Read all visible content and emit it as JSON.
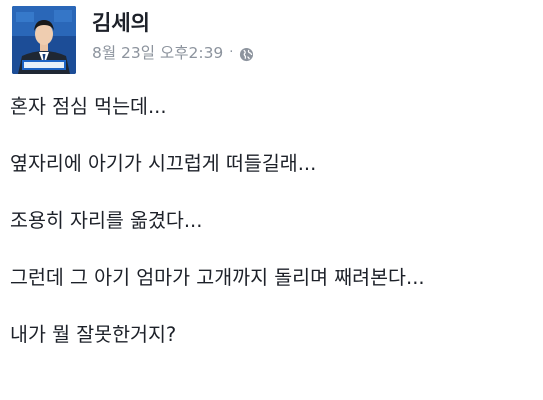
{
  "post": {
    "author": "김세의",
    "timestamp": "8월 23일 오후2:39",
    "separator": "·",
    "privacy_icon": "globe-icon",
    "avatar_caption": "김세의",
    "lines": [
      "혼자 점심 먹는데...",
      "옆자리에 아기가 시끄럽게 떠들길래...",
      "조용히 자리를 옮겼다...",
      "그런데 그 아기 엄마가 고개까지 돌리며 째려본다...",
      "내가 뭘 잘못한거지?"
    ]
  },
  "colors": {
    "text": "#1d2129",
    "meta": "#8d949e",
    "avatar_bg": "#1a4f9a"
  }
}
